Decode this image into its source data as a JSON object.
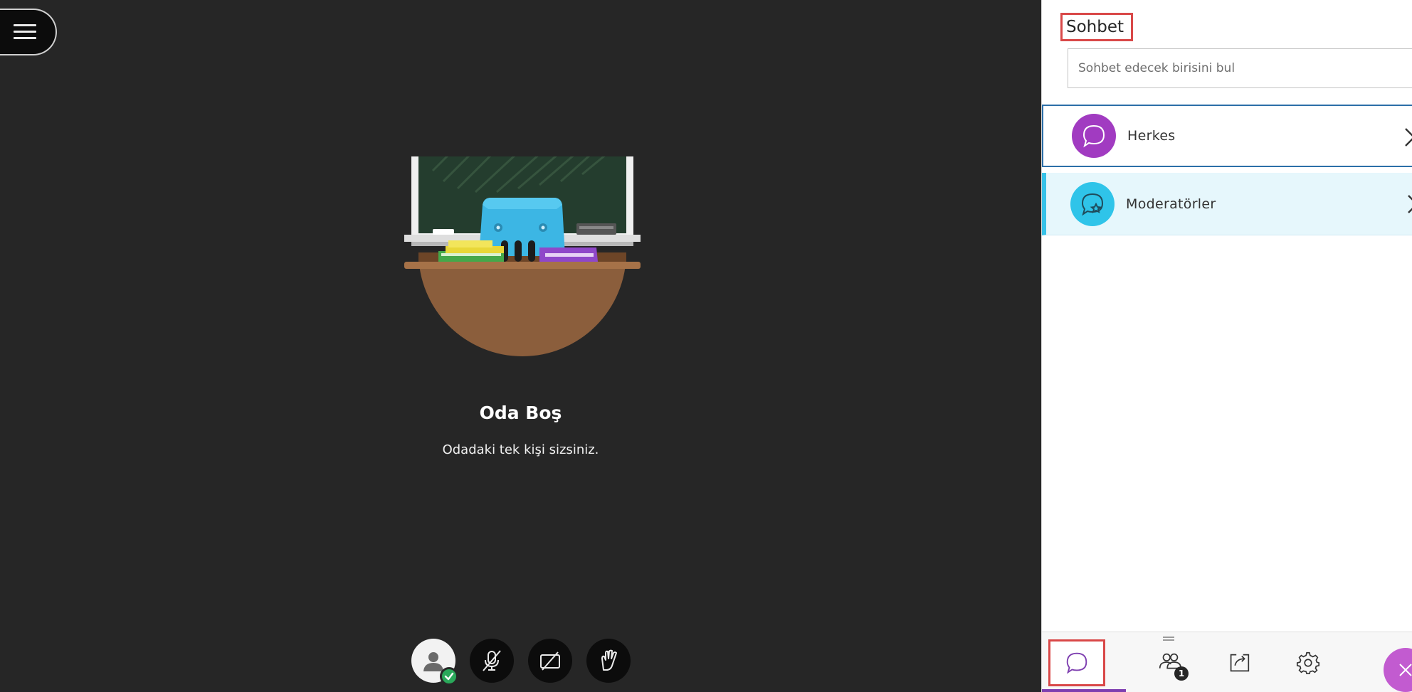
{
  "stage": {
    "menu_icon": "hamburger-menu-icon",
    "empty_title": "Oda Boş",
    "empty_subtitle": "Odadaki tek kişi sizsiniz.",
    "controls": [
      {
        "name": "profile-avatar",
        "icon": "user-avatar-icon",
        "status": "check-icon"
      },
      {
        "name": "microphone-toggle",
        "icon": "microphone-off-icon"
      },
      {
        "name": "camera-toggle",
        "icon": "camera-off-icon"
      },
      {
        "name": "raise-hand",
        "icon": "hand-icon"
      }
    ]
  },
  "chat": {
    "title": "Sohbet",
    "search_placeholder": "Sohbet edecek birisini bul",
    "channels": [
      {
        "label": "Herkes",
        "icon": "chat-bubble-icon",
        "color": "#a13bc1"
      },
      {
        "label": "Moderatörler",
        "icon": "moderator-chat-icon",
        "color": "#2fc4e9"
      }
    ]
  },
  "tabbar": {
    "attendee_count": "1",
    "tabs": [
      "chat-tab",
      "attendees-tab",
      "share-content-tab",
      "settings-tab"
    ],
    "accent": "#7e3fb0",
    "close_color": "#c25bd0"
  }
}
